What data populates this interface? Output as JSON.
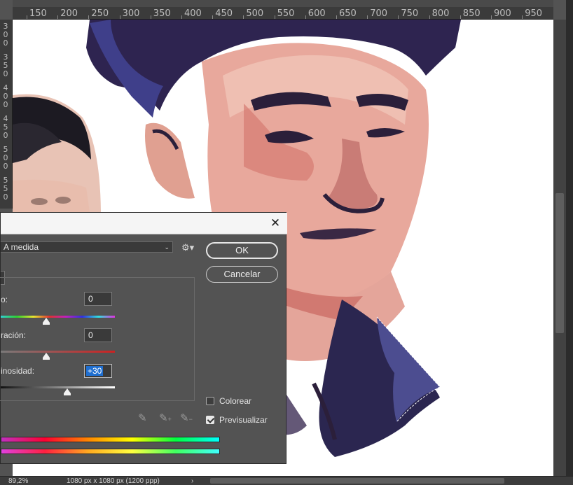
{
  "ruler": {
    "top_labels": [
      "150",
      "200",
      "250",
      "300",
      "350",
      "400",
      "450",
      "500",
      "550",
      "600",
      "650",
      "700",
      "750",
      "800",
      "850",
      "900",
      "950"
    ],
    "left_labels": [
      [
        "3",
        "0",
        "0"
      ],
      [
        "3",
        "5",
        "0"
      ],
      [
        "4",
        "0",
        "0"
      ],
      [
        "4",
        "5",
        "0"
      ],
      [
        "5",
        "0",
        "0"
      ],
      [
        "5",
        "5",
        "0"
      ]
    ]
  },
  "dialog": {
    "close_label": "✕",
    "preset_value": "A medida",
    "preset_arrow": "⌄",
    "settings_icon": "gear-icon",
    "ok_label": "OK",
    "cancel_label": "Cancelar",
    "hue_label": "o:",
    "hue_value": "0",
    "hue_level_pct": 40,
    "saturation_label": "ración:",
    "saturation_value": "0",
    "saturation_level_pct": 40,
    "lightness_label": "inosidad:",
    "lightness_value": "+30",
    "lightness_level_pct": 58,
    "colorize_label": "Colorear",
    "colorize_checked": false,
    "preview_label": "Previsualizar",
    "preview_checked": true,
    "eyedroppers": [
      "eyedropper-icon",
      "eyedropper-plus-icon",
      "eyedropper-minus-icon"
    ]
  },
  "status": {
    "zoom": "89,2%",
    "doc_info": "1080 px x 1080 px (1200 ppp)",
    "arrow": "›"
  }
}
